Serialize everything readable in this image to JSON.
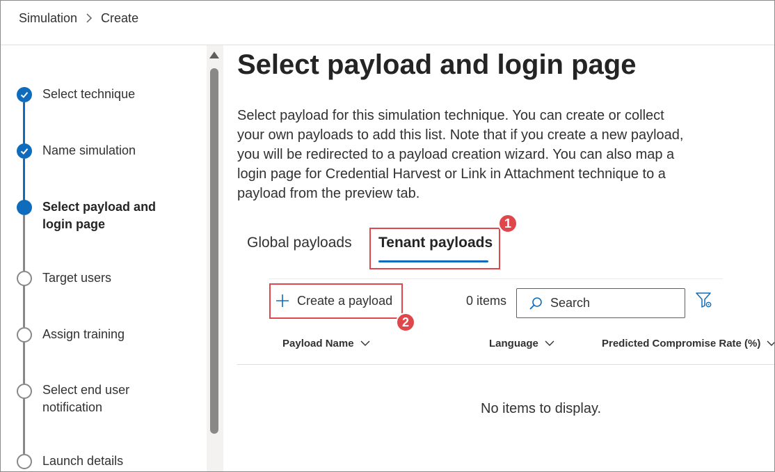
{
  "breadcrumb": {
    "items": [
      "Simulation",
      "Create"
    ]
  },
  "steps": [
    {
      "label": "Select technique",
      "status": "done"
    },
    {
      "label": "Name simulation",
      "status": "done"
    },
    {
      "label": "Select payload and login page",
      "status": "current"
    },
    {
      "label": "Target users",
      "status": "todo"
    },
    {
      "label": "Assign training",
      "status": "todo"
    },
    {
      "label": "Select end user notification",
      "status": "todo"
    },
    {
      "label": "Launch details",
      "status": "todo"
    }
  ],
  "main": {
    "title": "Select payload and login page",
    "description": "Select payload for this simulation technique. You can create or collect your own payloads to add this list. Note that if you create a new payload, you will be redirected to a payload creation wizard. You can also map a login page for Credential Harvest or Link in Attachment technique to a payload from the preview tab.",
    "tabs": [
      {
        "label": "Global payloads",
        "active": false
      },
      {
        "label": "Tenant payloads",
        "active": true
      }
    ],
    "toolbar": {
      "create_label": "Create a payload",
      "items_count": "0 items",
      "search_placeholder": "Search"
    },
    "table": {
      "columns": [
        "Payload Name",
        "Language",
        "Predicted Compromise Rate (%)"
      ],
      "empty_message": "No items to display."
    }
  },
  "annotations": {
    "badge_1": "1",
    "badge_2": "2",
    "highlight_color": "#e0474c"
  },
  "colors": {
    "accent": "#0f6cbd",
    "inactive_step": "#8a8886"
  },
  "icons": [
    "chevron-right-icon",
    "check-icon",
    "plus-icon",
    "search-icon",
    "filter-settings-icon",
    "chevron-down-icon"
  ]
}
